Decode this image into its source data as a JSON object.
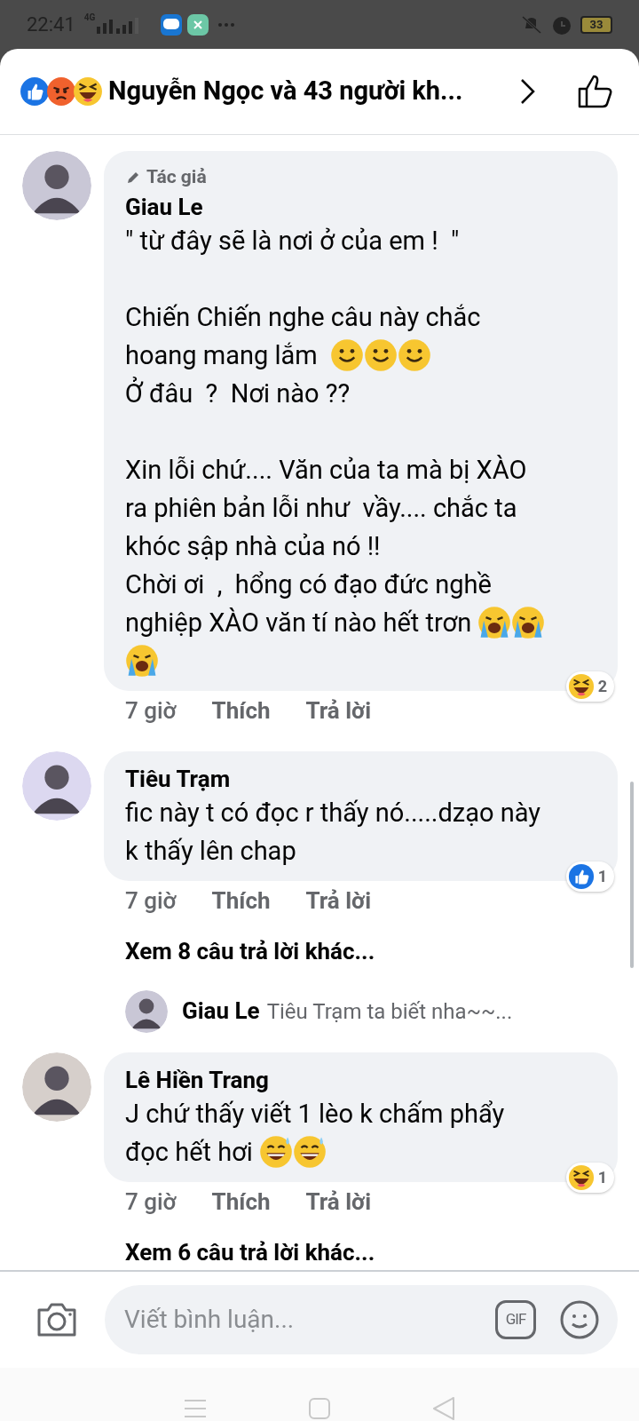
{
  "status_bar": {
    "time": "22:41",
    "network": "4G",
    "battery": "33"
  },
  "header": {
    "reactions": [
      {
        "kind": "like"
      },
      {
        "kind": "angry"
      },
      {
        "kind": "haha"
      }
    ],
    "title": "Nguyễn Ngọc và 43 người kh..."
  },
  "comments": [
    {
      "author_badge": "Tác giả",
      "name": "Giau Le",
      "paragraphs": [
        [
          {
            "text": "\" từ đây sẽ là nơi ở của em !  \""
          }
        ],
        [
          {
            "text": "Chiến Chiến nghe câu này chắc"
          },
          {
            "text": "hoang mang lắm  ",
            "emojis": [
              {
                "kind": "smile"
              },
              {
                "kind": "smile"
              },
              {
                "kind": "smile"
              }
            ]
          },
          {
            "text": "Ở đâu  ?  Nơi nào ??"
          }
        ],
        [
          {
            "text": "Xin lỗi chứ.... Văn của ta mà bị XÀO"
          },
          {
            "text": "ra phiên bản lỗi như  vầy.... chắc ta"
          },
          {
            "text": "khóc sập nhà của nó !!"
          },
          {
            "text": "Chời ơi  ,  hổng có đạo đức nghề"
          },
          {
            "text": "nghiệp XÀO văn tí nào hết trơn ",
            "emojis": [
              {
                "kind": "cry"
              },
              {
                "kind": "cry"
              }
            ]
          },
          {
            "emojis": [
              {
                "kind": "cry"
              }
            ]
          }
        ]
      ],
      "time": "7 giờ",
      "like": "Thích",
      "reply": "Trả lời",
      "reaction": {
        "kind": "haha",
        "count": "2"
      }
    },
    {
      "name": "Tiêu Trạm",
      "paragraphs": [
        [
          {
            "text": "fic này t có đọc r thấy nó.....dzạo này"
          },
          {
            "text": "k thấy lên chap"
          }
        ]
      ],
      "time": "7 giờ",
      "like": "Thích",
      "reply": "Trả lời",
      "reaction": {
        "kind": "like",
        "count": "1"
      },
      "more_replies": "Xem 8 câu trả lời khác...",
      "reply_preview": {
        "name": "Giau Le",
        "text": "Tiêu Trạm ta biết nha~~..."
      }
    },
    {
      "name": "Lê Hiền Trang",
      "paragraphs": [
        [
          {
            "text": "J chứ thấy viết 1 lèo k chấm phẩy"
          },
          {
            "text": "đọc hết hơi ",
            "emojis": [
              {
                "kind": "sweat"
              },
              {
                "kind": "sweat"
              }
            ]
          }
        ]
      ],
      "time": "7 giờ",
      "like": "Thích",
      "reply": "Trả lời",
      "reaction": {
        "kind": "haha",
        "count": "1"
      },
      "more_replies": "Xem 6 câu trả lời khác..."
    }
  ],
  "composer": {
    "placeholder": "Viết bình luận...",
    "gif": "GIF"
  }
}
